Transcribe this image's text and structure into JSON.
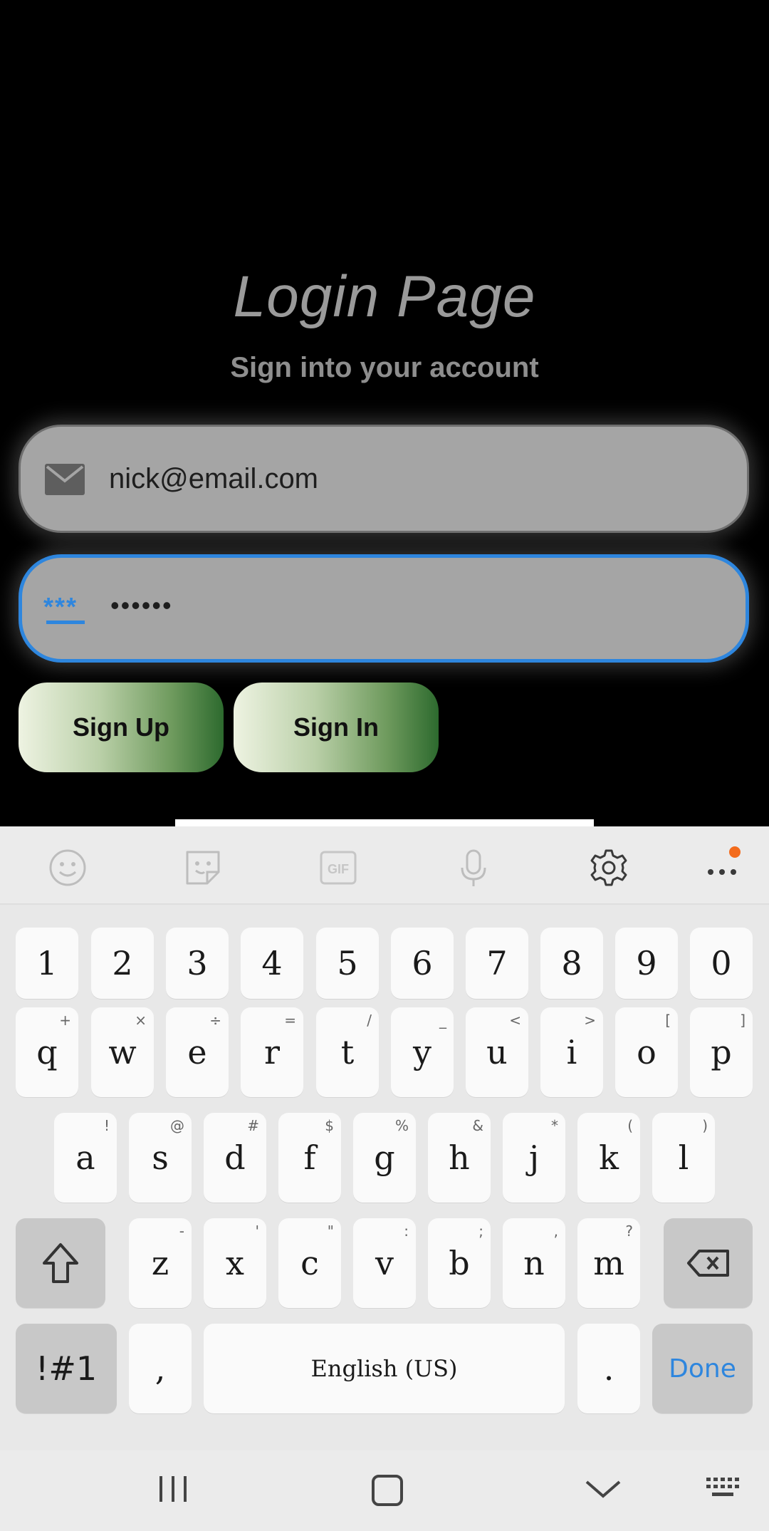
{
  "login": {
    "title": "Login Page",
    "subtitle": "Sign into your account",
    "email_value": "nick@email.com",
    "password_value": "••••••",
    "password_icon_text": "***",
    "signup_label": "Sign Up",
    "signin_label": "Sign In"
  },
  "colors": {
    "accent": "#2e86de",
    "field_bg": "#a5a5a5",
    "button_gradient_end": "#2d6a2e",
    "notification_dot": "#f36b1c"
  },
  "keyboard": {
    "toolbar_icons": [
      "emoji-icon",
      "sticker-icon",
      "gif-icon",
      "microphone-icon",
      "settings-icon",
      "more-icon"
    ],
    "gif_label": "GIF",
    "number_row": [
      "1",
      "2",
      "3",
      "4",
      "5",
      "6",
      "7",
      "8",
      "9",
      "0"
    ],
    "row1": [
      {
        "k": "q",
        "s": "+"
      },
      {
        "k": "w",
        "s": "×"
      },
      {
        "k": "e",
        "s": "÷"
      },
      {
        "k": "r",
        "s": "="
      },
      {
        "k": "t",
        "s": "/"
      },
      {
        "k": "y",
        "s": "_"
      },
      {
        "k": "u",
        "s": "<"
      },
      {
        "k": "i",
        "s": ">"
      },
      {
        "k": "o",
        "s": "["
      },
      {
        "k": "p",
        "s": "]"
      }
    ],
    "row2": [
      {
        "k": "a",
        "s": "!"
      },
      {
        "k": "s",
        "s": "@"
      },
      {
        "k": "d",
        "s": "#"
      },
      {
        "k": "f",
        "s": "$"
      },
      {
        "k": "g",
        "s": "%"
      },
      {
        "k": "h",
        "s": "&"
      },
      {
        "k": "j",
        "s": "*"
      },
      {
        "k": "k",
        "s": "("
      },
      {
        "k": "l",
        "s": ")"
      }
    ],
    "row3": [
      {
        "k": "z",
        "s": "-"
      },
      {
        "k": "x",
        "s": "'"
      },
      {
        "k": "c",
        "s": "\""
      },
      {
        "k": "v",
        "s": ":"
      },
      {
        "k": "b",
        "s": ";"
      },
      {
        "k": "n",
        "s": ","
      },
      {
        "k": "m",
        "s": "?"
      }
    ],
    "symbols_label": "!#1",
    "comma_label": ",",
    "space_label": "English (US)",
    "period_label": ".",
    "done_label": "Done"
  },
  "navbar": {
    "icons": [
      "recent-apps-icon",
      "home-icon",
      "back-icon",
      "keyboard-switch-icon"
    ]
  }
}
